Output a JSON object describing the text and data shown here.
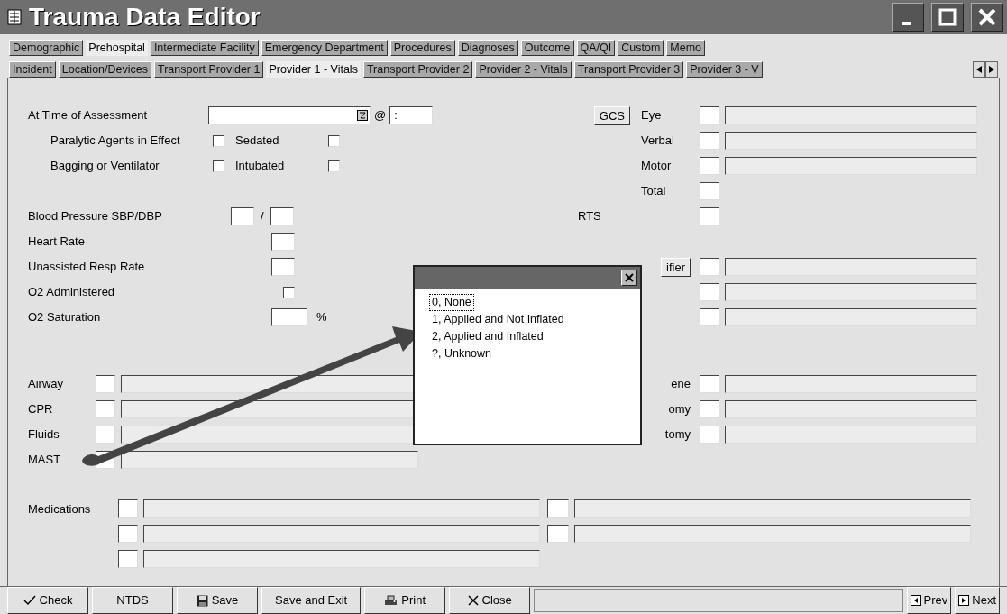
{
  "window": {
    "title": "Trauma Data Editor"
  },
  "tabs": [
    {
      "label": "Demographic",
      "selected": false
    },
    {
      "label": "Prehospital",
      "selected": true
    },
    {
      "label": "Intermediate Facility",
      "selected": false
    },
    {
      "label": "Emergency Department",
      "selected": false
    },
    {
      "label": "Procedures",
      "selected": false
    },
    {
      "label": "Diagnoses",
      "selected": false
    },
    {
      "label": "Outcome",
      "selected": false
    },
    {
      "label": "QA/QI",
      "selected": false
    },
    {
      "label": "Custom",
      "selected": false
    },
    {
      "label": "Memo",
      "selected": false
    }
  ],
  "subtabs": [
    {
      "label": "Incident",
      "selected": false
    },
    {
      "label": "Location/Devices",
      "selected": false
    },
    {
      "label": "Transport Provider 1",
      "selected": false
    },
    {
      "label": "Provider 1 - Vitals",
      "selected": true
    },
    {
      "label": "Transport Provider 2",
      "selected": false
    },
    {
      "label": "Provider 2 - Vitals",
      "selected": false
    },
    {
      "label": "Transport Provider 3",
      "selected": false
    },
    {
      "label": "Provider 3 - V",
      "selected": false
    }
  ],
  "assessment": {
    "label": "At Time of Assessment",
    "at_sign": "@",
    "time_separator": ":"
  },
  "flags": [
    {
      "label": "Paralytic Agents in Effect",
      "checked": false
    },
    {
      "label": "Sedated",
      "checked": false
    },
    {
      "label": "Bagging or Ventilator",
      "checked": false
    },
    {
      "label": "Intubated",
      "checked": false
    }
  ],
  "vitals": {
    "bp_label": "Blood Pressure SBP/DBP",
    "bp_separator": "/",
    "heart_rate": "Heart Rate",
    "resp_rate": "Unassisted Resp Rate",
    "o2_administered": {
      "label": "O2 Administered",
      "checked": false
    },
    "o2_saturation": {
      "label": "O2 Saturation",
      "unit": "%"
    }
  },
  "gcs": {
    "button": "GCS",
    "rows": [
      {
        "label": "Eye",
        "description": true
      },
      {
        "label": "Verbal",
        "description": true
      },
      {
        "label": "Motor",
        "description": true
      },
      {
        "label": "Total",
        "description": false
      }
    ]
  },
  "rts": {
    "label": "RTS"
  },
  "right_rows": [
    {
      "kind": "button",
      "label": "ifier"
    },
    {
      "kind": "blank"
    },
    {
      "kind": "blank"
    }
  ],
  "interventions": [
    {
      "label": "Airway"
    },
    {
      "label": "CPR"
    },
    {
      "label": "Fluids"
    },
    {
      "label": "MAST"
    }
  ],
  "right_interventions": [
    {
      "label": "ene"
    },
    {
      "label": "omy"
    },
    {
      "label": "tomy"
    }
  ],
  "medications": {
    "label": "Medications",
    "rows": [
      {
        "right_field": true
      },
      {
        "right_field": true
      },
      {
        "right_field": false
      }
    ]
  },
  "popup": {
    "items": [
      {
        "label": "0, None",
        "selected": true
      },
      {
        "label": "1, Applied and Not Inflated",
        "selected": false
      },
      {
        "label": "2, Applied and Inflated",
        "selected": false
      },
      {
        "label": "?, Unknown",
        "selected": false
      }
    ]
  },
  "toolbar": [
    {
      "label": "Check",
      "kind": "check"
    },
    {
      "label": "NTDS",
      "kind": "plain"
    },
    {
      "label": "Save",
      "kind": "save"
    },
    {
      "label": "Save and Exit",
      "kind": "plain"
    },
    {
      "label": "Print",
      "kind": "print"
    },
    {
      "label": "Close",
      "kind": "close"
    }
  ],
  "nav": [
    {
      "label": "Prev",
      "kind": "prev"
    },
    {
      "label": "Next",
      "kind": "next"
    }
  ]
}
